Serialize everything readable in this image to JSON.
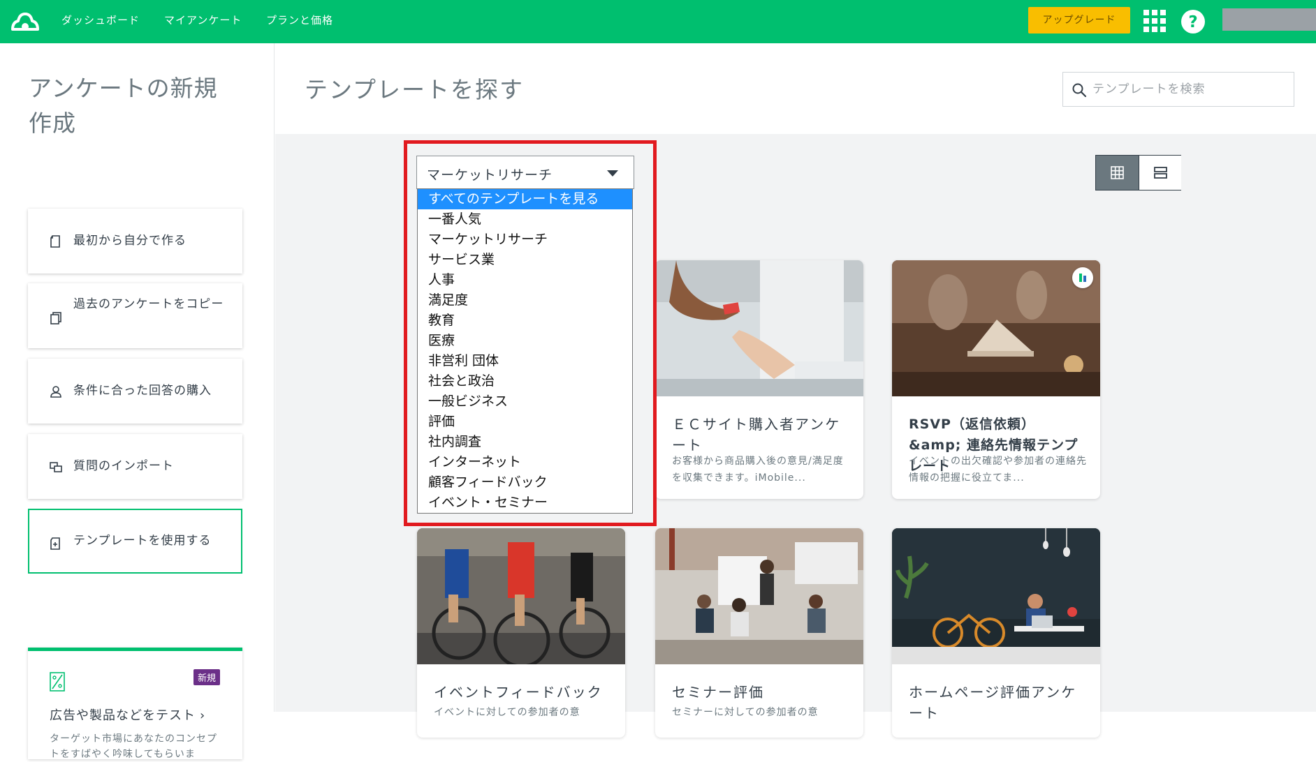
{
  "nav": {
    "links": [
      "ダッシュボード",
      "マイアンケート",
      "プランと価格"
    ],
    "upgrade_label": "アップグレード"
  },
  "left": {
    "title": "アンケートの新規作成",
    "options": [
      {
        "label": "最初から自分で作る",
        "icon": "blank-doc-icon"
      },
      {
        "label": "過去のアンケートをコピー",
        "icon": "copy-doc-icon"
      },
      {
        "label": "条件に合った回答の購入",
        "icon": "audience-icon"
      },
      {
        "label": "質問のインポート",
        "icon": "import-icon"
      },
      {
        "label": "テンプレートを使用する",
        "icon": "template-icon",
        "active": true
      }
    ],
    "promo": {
      "badge": "新規",
      "title": "広告や製品などをテスト",
      "desc": "ターゲット市場にあなたのコンセプトをすばやく吟味してもらいま"
    }
  },
  "main": {
    "title": "テンプレートを探す",
    "search_placeholder": "テンプレートを検索"
  },
  "category_select": {
    "value": "マーケットリサーチ",
    "options": [
      "すべてのテンプレートを見る",
      "一番人気",
      "マーケットリサーチ",
      "サービス業",
      "人事",
      "満足度",
      "教育",
      "医療",
      "非営利 団体",
      "社会と政治",
      "一般ビジネス",
      "評価",
      "社内調査",
      "インターネット",
      "顧客フィードバック",
      "イベント・セミナー"
    ],
    "highlighted_index": 0
  },
  "templates": [
    {
      "title": "ＥＣサイト購入者アンケート",
      "desc": "お客様から商品購入後の意見/満足度を収集できます。iMobile..."
    },
    {
      "title": "RSVP（返信依頼）&amp; 連絡先情報テンプレート",
      "desc": "イベントの出欠確認や参加者の連絡先情報の把握に役立てま..."
    },
    {
      "title": "イベントフィードバック",
      "desc": "イベントに対しての参加者の意"
    },
    {
      "title": "セミナー評価",
      "desc": "セミナーに対しての参加者の意"
    },
    {
      "title": "ホームページ評価アンケート",
      "desc": ""
    }
  ],
  "colors": {
    "brand": "#00bf6f",
    "upgrade": "#f9be00",
    "highlight_box": "#e11a1f",
    "option_selected": "#1e90ff"
  }
}
